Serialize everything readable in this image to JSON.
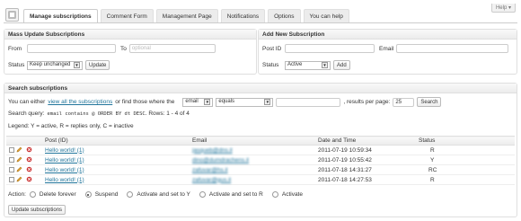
{
  "header": {
    "help_label": "Help",
    "help_arrow": "▾",
    "tabs": [
      {
        "label": "Manage subscriptions",
        "active": true
      },
      {
        "label": "Comment Form",
        "active": false
      },
      {
        "label": "Management Page",
        "active": false
      },
      {
        "label": "Notifications",
        "active": false
      },
      {
        "label": "Options",
        "active": false
      },
      {
        "label": "You can help",
        "active": false
      }
    ]
  },
  "mass_update": {
    "title": "Mass Update Subscriptions",
    "from_label": "From",
    "to_label": "To",
    "to_placeholder": "optional",
    "status_label": "Status",
    "status_value": "Keep unchanged",
    "update_button": "Update"
  },
  "add_new": {
    "title": "Add New Subscription",
    "post_id_label": "Post ID",
    "email_label": "Email",
    "status_label": "Status",
    "status_value": "Active",
    "add_button": "Add"
  },
  "search": {
    "title": "Search subscriptions",
    "intro_before": "You can either",
    "view_all_link": "view all the subscriptions",
    "intro_after": "or find those where the",
    "field_value": "email",
    "operator_value": "equals",
    "results_label": ", results per page:",
    "per_page": "25",
    "search_button": "Search",
    "query_label": "Search query:",
    "query_text": "email contains @ ORDER BY dt DESC",
    "rows_text": ". Rows: 1 - 4 of 4",
    "legend": "Legend: Y = active, R = replies only, C = inactive"
  },
  "table": {
    "columns": [
      "Post (ID)",
      "Email",
      "Date and Time",
      "Status"
    ],
    "rows": [
      {
        "post": "Hello world! (1)",
        "email": "jasqueb@dns.il",
        "datetime": "2011-07-19 10:59:34",
        "status": "R"
      },
      {
        "post": "Hello world! (1)",
        "email": "dino@dumdrachens.il",
        "datetime": "2011-07-19 10:55:42",
        "status": "Y"
      },
      {
        "post": "Hello world! (1)",
        "email": "zafuvar@hs.il",
        "datetime": "2011-07-18 14:31:27",
        "status": "RC"
      },
      {
        "post": "Hello world! (1)",
        "email": "zafuvar@gus.il",
        "datetime": "2011-07-18 14:27:53",
        "status": "R"
      }
    ]
  },
  "actions": {
    "label": "Action:",
    "options": [
      {
        "label": "Delete forever",
        "checked": false
      },
      {
        "label": "Suspend",
        "checked": true
      },
      {
        "label": "Activate and set to Y",
        "checked": false
      },
      {
        "label": "Activate and set to R",
        "checked": false
      },
      {
        "label": "Activate",
        "checked": false
      }
    ],
    "update_button": "Update subscriptions"
  },
  "colors": {
    "link": "#21759b",
    "panel_border": "#dfdfdf"
  },
  "icons": {
    "edit": "pencil-icon",
    "delete": "delete-icon",
    "logo": "plugin-logo-icon"
  }
}
